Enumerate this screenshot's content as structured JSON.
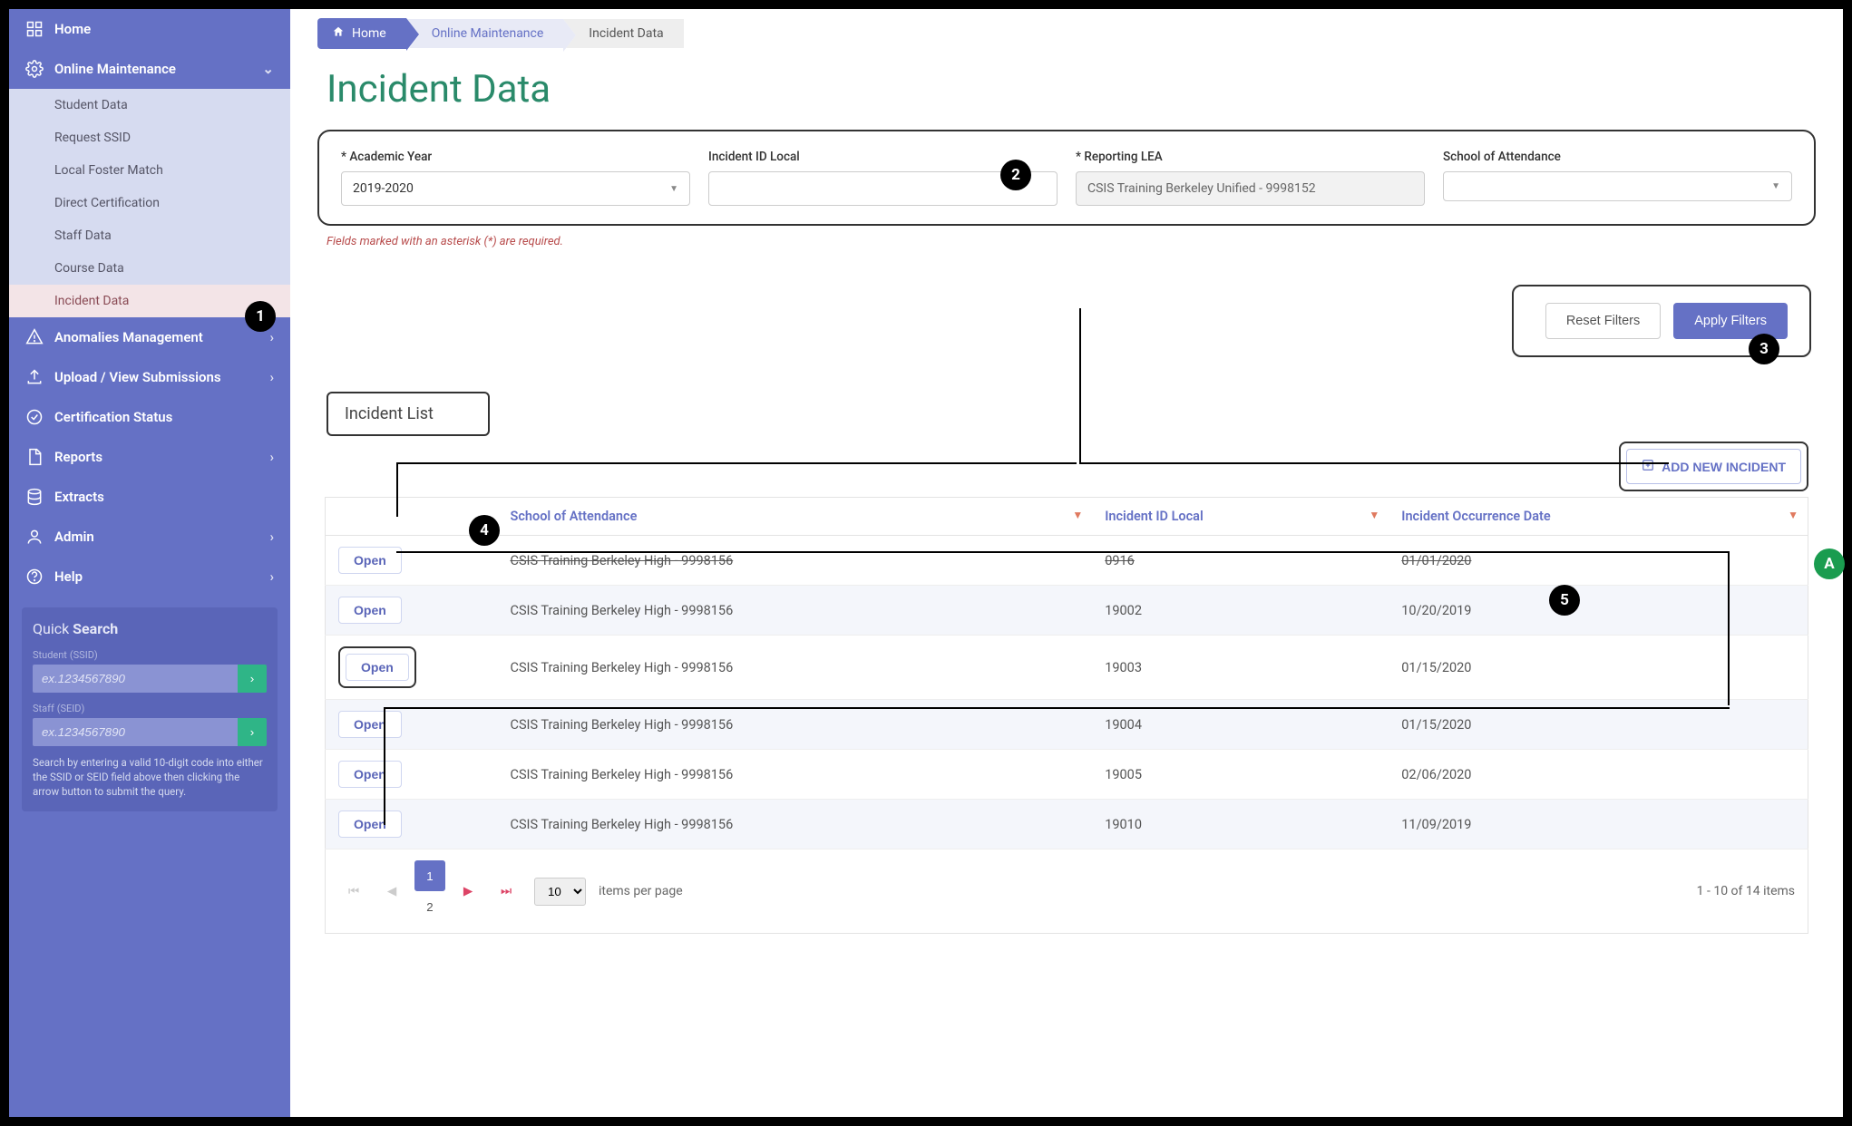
{
  "sidebar": {
    "home": "Home",
    "online_maintenance": "Online Maintenance",
    "subs": [
      {
        "label": "Student Data",
        "active": false
      },
      {
        "label": "Request SSID",
        "active": false
      },
      {
        "label": "Local Foster Match",
        "active": false
      },
      {
        "label": "Direct Certification",
        "active": false
      },
      {
        "label": "Staff Data",
        "active": false
      },
      {
        "label": "Course Data",
        "active": false
      },
      {
        "label": "Incident Data",
        "active": true
      }
    ],
    "anomalies": "Anomalies Management",
    "upload": "Upload / View Submissions",
    "cert": "Certification Status",
    "reports": "Reports",
    "extracts": "Extracts",
    "admin": "Admin",
    "help": "Help"
  },
  "quick_search": {
    "title_a": "Quick ",
    "title_b": "Search",
    "student_label": "Student",
    "student_paren": "(SSID)",
    "staff_label": "Staff",
    "staff_paren": "(SEID)",
    "placeholder": "ex.1234567890",
    "hint": "Search by entering a valid 10-digit code into either the SSID or SEID field above then clicking the arrow button to submit the query."
  },
  "breadcrumb": {
    "home": "Home",
    "mid": "Online Maintenance",
    "last": "Incident Data"
  },
  "page_title": "Incident Data",
  "filters": {
    "year_label": "* Academic Year",
    "year_value": "2019-2020",
    "incident_id_label": "Incident ID Local",
    "incident_id_value": "",
    "lea_label": "* Reporting LEA",
    "lea_value": "CSIS Training Berkeley Unified - 9998152",
    "school_label": "School of Attendance",
    "school_value": ""
  },
  "required_note": "Fields marked with an asterisk (*) are required.",
  "buttons": {
    "reset": "Reset Filters",
    "apply": "Apply Filters",
    "add_new": "ADD NEW INCIDENT",
    "open": "Open"
  },
  "section_header": "Incident List",
  "table": {
    "col_school": "School of Attendance",
    "col_incident": "Incident ID Local",
    "col_date": "Incident Occurrence Date",
    "rows": [
      {
        "school": "CSIS Training Berkeley High - 9998156",
        "id": "0916",
        "date": "01/01/2020"
      },
      {
        "school": "CSIS Training Berkeley High - 9998156",
        "id": "19002",
        "date": "10/20/2019"
      },
      {
        "school": "CSIS Training Berkeley High - 9998156",
        "id": "19003",
        "date": "01/15/2020"
      },
      {
        "school": "CSIS Training Berkeley High - 9998156",
        "id": "19004",
        "date": "01/15/2020"
      },
      {
        "school": "CSIS Training Berkeley High - 9998156",
        "id": "19005",
        "date": "02/06/2020"
      },
      {
        "school": "CSIS Training Berkeley High - 9998156",
        "id": "19010",
        "date": "11/09/2019"
      }
    ]
  },
  "pager": {
    "pages": [
      "1",
      "2"
    ],
    "active": "1",
    "size": "10",
    "label": "items per page",
    "summary": "1 - 10 of 14 items"
  },
  "callouts": {
    "c1": "1",
    "c2": "2",
    "c3": "3",
    "c4": "4",
    "c5": "5",
    "cA": "A"
  }
}
